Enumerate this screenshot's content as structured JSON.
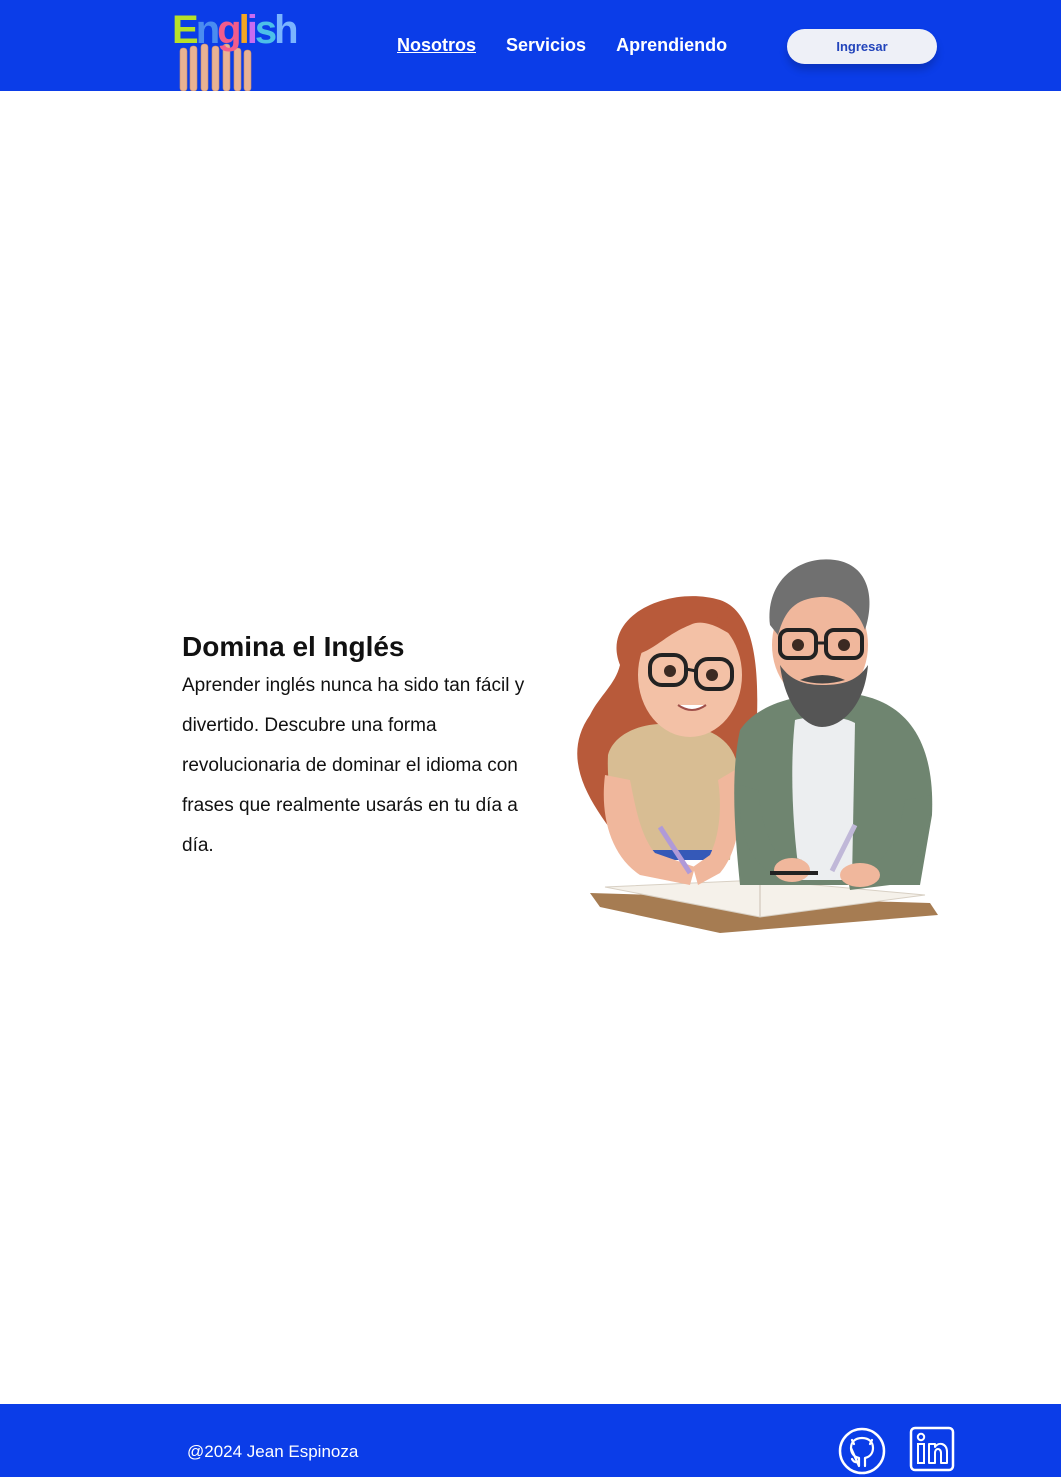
{
  "header": {
    "logo_text": "English",
    "logo_letters": [
      "E",
      "n",
      "g",
      "l",
      "i",
      "s",
      "h"
    ],
    "logo_colors": [
      "#b6e02a",
      "#4a8cf0",
      "#f25c8b",
      "#f5a623",
      "#c86cf0",
      "#4cc0e8",
      "#7ab4ff"
    ],
    "nav": [
      {
        "label": "Nosotros",
        "active": true
      },
      {
        "label": "Servicios",
        "active": false
      },
      {
        "label": "Aprendiendo",
        "active": false
      }
    ],
    "login_label": "Ingresar"
  },
  "hero": {
    "title": "Domina el Inglés",
    "description": "Aprender inglés nunca ha sido tan fácil y divertido. Descubre una forma revolucionaria de dominar el idioma con frases que realmente usarás en tu día a día.",
    "image": "two-people-studying-illustration"
  },
  "footer": {
    "copyright": "@2024 Jean Espinoza",
    "icons": [
      "github-icon",
      "linkedin-icon"
    ]
  },
  "colors": {
    "brand_blue": "#0b3de8",
    "button_bg": "#eef0f7",
    "button_text": "#2244bb"
  }
}
